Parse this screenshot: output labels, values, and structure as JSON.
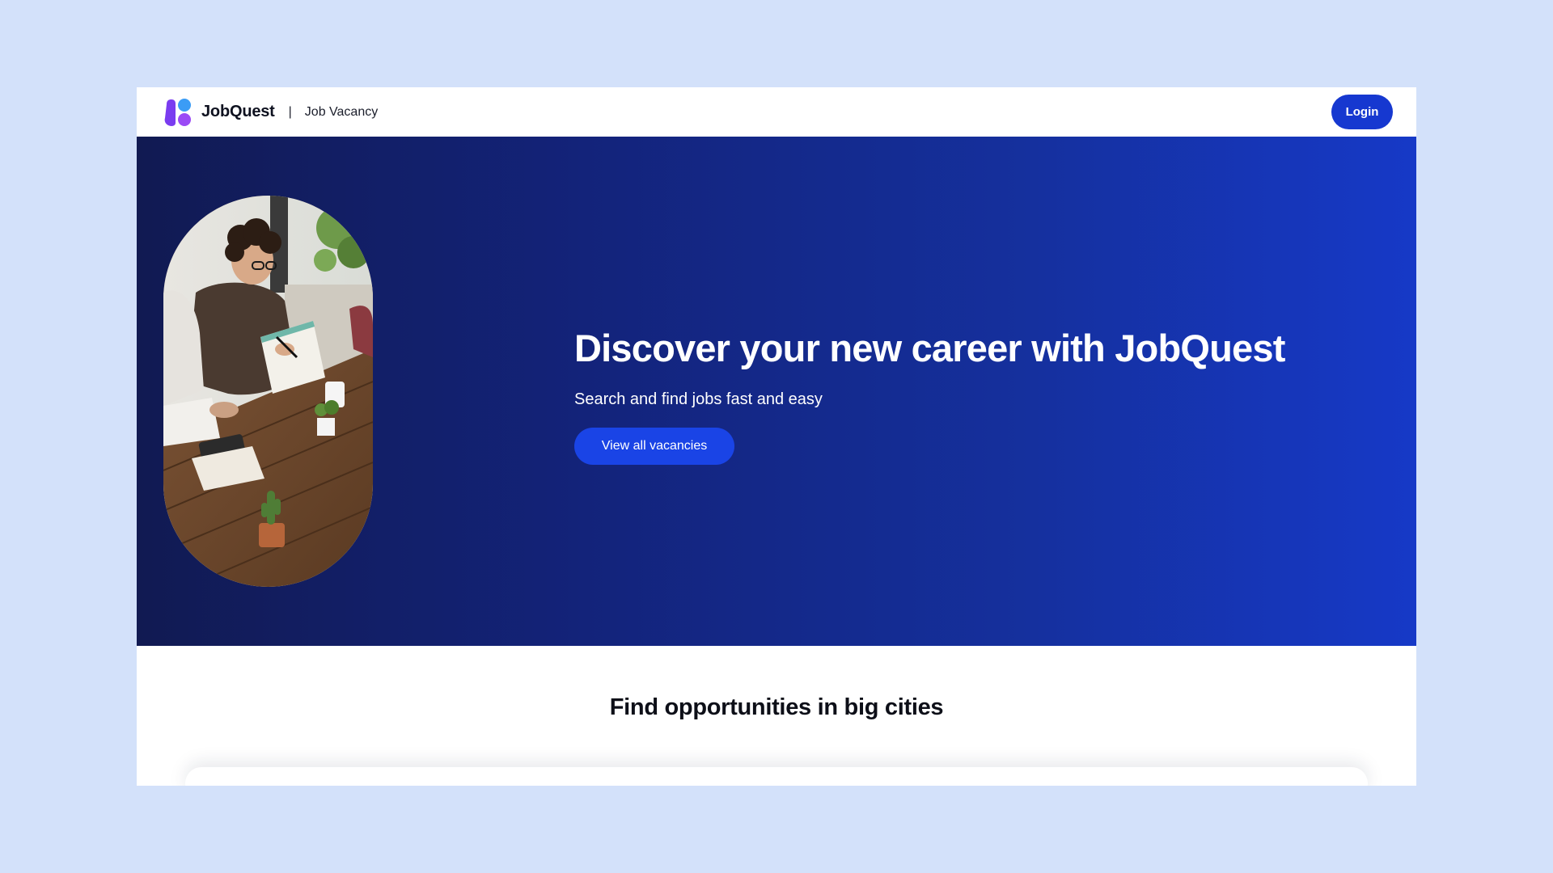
{
  "header": {
    "brand_name": "JobQuest",
    "separator": "|",
    "section_label": "Job Vacancy",
    "login_label": "Login"
  },
  "hero": {
    "title": "Discover your new career with JobQuest",
    "subtitle": "Search and find jobs fast and easy",
    "cta_label": "View all vacancies"
  },
  "cities": {
    "title": "Find opportunities in big cities"
  },
  "colors": {
    "page_background": "#d3e1fa",
    "primary_button": "#1638d0",
    "hero_gradient_start": "#111a52",
    "hero_gradient_end": "#1639c7",
    "logo_purple": "#7a3cf0",
    "logo_blue": "#3b9cf5",
    "logo_violet": "#9a4af5"
  },
  "icons": {
    "logo": "jobquest-logo-icon"
  }
}
